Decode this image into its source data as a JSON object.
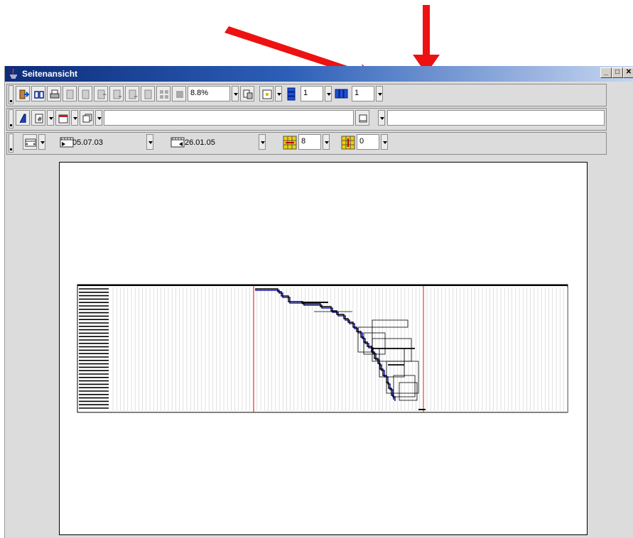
{
  "window": {
    "title": "Seitenansicht"
  },
  "toolbar1": {
    "zoom_value": "8.8%",
    "pages_down_value": "1",
    "pages_across_value": "1"
  },
  "toolbar3": {
    "start_date": "05.07.03",
    "end_date": "26.01.05",
    "rows_value": "8",
    "columns_value": "0"
  },
  "colors": {
    "arrow": "#ee1111",
    "titlebar_start": "#0d2c7a",
    "titlebar_end": "#c6d6f0",
    "today_line": "#ee1111",
    "baseline": "#1a1aa0"
  }
}
